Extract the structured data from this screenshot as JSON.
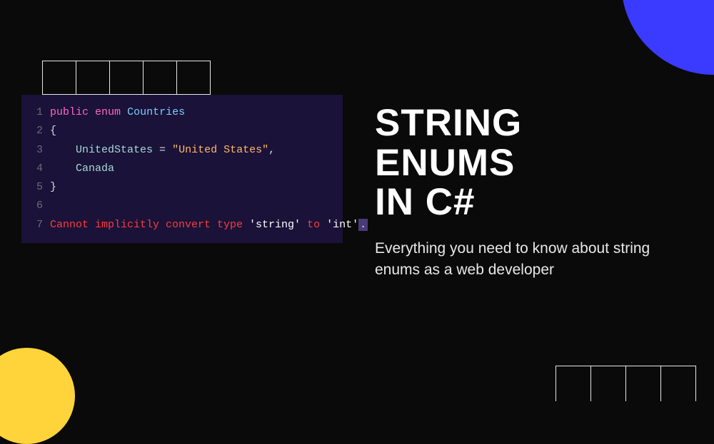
{
  "code": {
    "lines": [
      {
        "num": "1",
        "tokens": [
          {
            "cls": "tok-keyword",
            "t": "public"
          },
          {
            "cls": "",
            "t": " "
          },
          {
            "cls": "tok-keyword",
            "t": "enum"
          },
          {
            "cls": "",
            "t": " "
          },
          {
            "cls": "tok-type",
            "t": "Countries"
          }
        ]
      },
      {
        "num": "2",
        "tokens": [
          {
            "cls": "tok-punct",
            "t": "{"
          }
        ]
      },
      {
        "num": "3",
        "tokens": [
          {
            "cls": "",
            "t": "    "
          },
          {
            "cls": "tok-ident",
            "t": "UnitedStates"
          },
          {
            "cls": "tok-punct",
            "t": " = "
          },
          {
            "cls": "tok-string",
            "t": "\"United States\""
          },
          {
            "cls": "tok-punct",
            "t": ","
          }
        ]
      },
      {
        "num": "4",
        "tokens": [
          {
            "cls": "",
            "t": "    "
          },
          {
            "cls": "tok-ident",
            "t": "Canada"
          }
        ]
      },
      {
        "num": "5",
        "tokens": [
          {
            "cls": "tok-punct",
            "t": "}"
          }
        ]
      },
      {
        "num": "6",
        "tokens": []
      },
      {
        "num": "7",
        "tokens": [
          {
            "cls": "tok-error",
            "t": "Cannot implicitly convert type "
          },
          {
            "cls": "tok-error-str",
            "t": "'string'"
          },
          {
            "cls": "tok-error",
            "t": " to "
          },
          {
            "cls": "tok-error-str",
            "t": "'int'"
          },
          {
            "cls": "tok-cursor",
            "t": "."
          }
        ]
      }
    ]
  },
  "heading": {
    "title_l1": "STRING",
    "title_l2": "ENUMS",
    "title_l3": "IN C#",
    "subtitle": "Everything you need to know about string enums as a web developer"
  },
  "grid": {
    "top_cells": 5,
    "bottom_cells": 4
  },
  "colors": {
    "bg": "#0a0a0a",
    "accent_blue": "#3b3bff",
    "accent_yellow": "#ffd43b",
    "code_bg": "#1a1238"
  }
}
